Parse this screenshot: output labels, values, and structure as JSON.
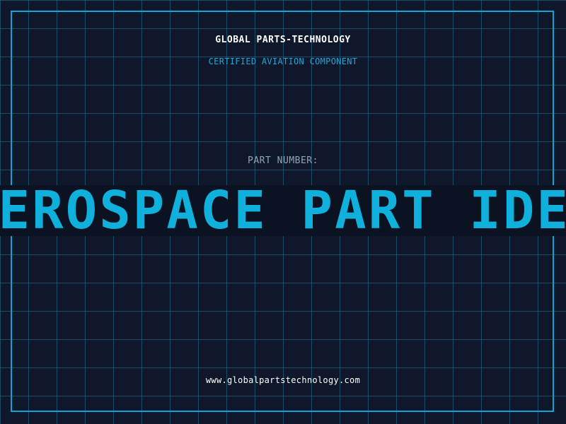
{
  "header": {
    "company_name": "GLOBAL PARTS-TECHNOLOGY",
    "certification": "CERTIFIED AVIATION COMPONENT"
  },
  "part": {
    "label": "PART NUMBER:",
    "banner_text": "AEROSPACE PART IDENTIFICATION"
  },
  "footer": {
    "website": "www.globalpartstechnology.com"
  },
  "colors": {
    "background": "#0f172a",
    "grid": "#227896",
    "frame": "#0ea5d6",
    "accent": "#0fb1dc"
  }
}
